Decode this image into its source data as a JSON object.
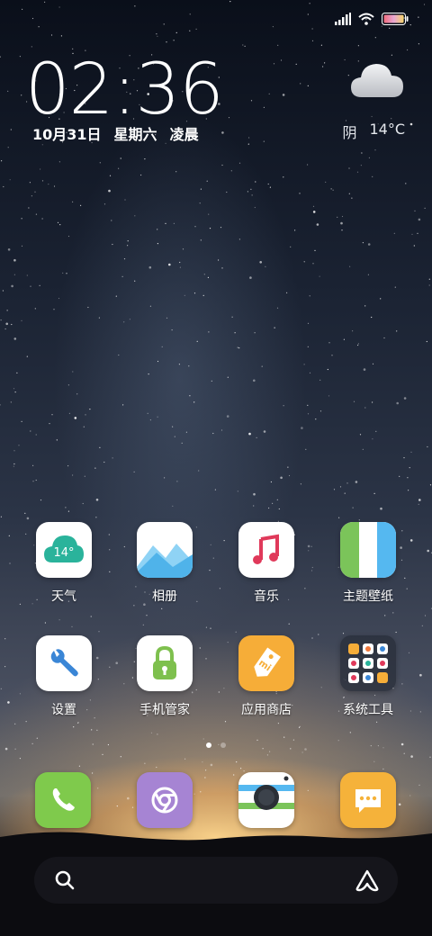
{
  "status_bar": {
    "icons": [
      "signal-icon",
      "wifi-icon",
      "battery-icon"
    ]
  },
  "clock": {
    "time": "02:36",
    "date": "10月31日",
    "weekday": "星期六",
    "period": "凌晨"
  },
  "weather": {
    "icon": "cloud-icon",
    "condition": "阴",
    "temperature": "14°C"
  },
  "apps": [
    {
      "label": "天气",
      "icon": "weather-app-icon",
      "badge": "14°"
    },
    {
      "label": "相册",
      "icon": "gallery-icon"
    },
    {
      "label": "音乐",
      "icon": "music-icon"
    },
    {
      "label": "主题壁纸",
      "icon": "themes-icon"
    },
    {
      "label": "设置",
      "icon": "settings-icon"
    },
    {
      "label": "手机管家",
      "icon": "security-icon"
    },
    {
      "label": "应用商店",
      "icon": "app-store-icon",
      "badge": "mi"
    },
    {
      "label": "系统工具",
      "icon": "tools-folder-icon"
    }
  ],
  "page_indicator": {
    "current": 1,
    "total": 2
  },
  "dock": [
    "phone-icon",
    "browser-icon",
    "camera-icon",
    "messages-icon"
  ],
  "search_bar": {
    "left_icon": "search-icon",
    "right_icon": "assistant-icon"
  },
  "colors": {
    "weather": "#2ab39b",
    "music": "#e0395a",
    "themes_green": "#7bc45a",
    "themes_blue": "#55b8f0",
    "settings": "#3a86d6",
    "security": "#7ec04e",
    "store": "#f6ad38",
    "phone": "#7fca4c",
    "browser": "#a684d3",
    "messages": "#f5b23a"
  }
}
